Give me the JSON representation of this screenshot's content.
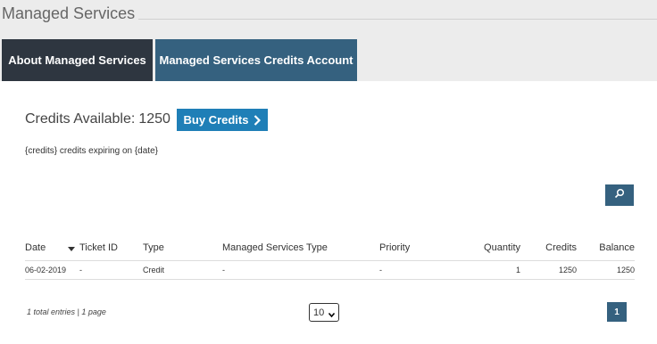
{
  "page": {
    "title": "Managed Services"
  },
  "tabs": [
    {
      "label": "About Managed Services"
    },
    {
      "label": "Managed Services Credits Account"
    }
  ],
  "credits": {
    "label": "Credits Available:",
    "value": "1250",
    "buy_label": "Buy Credits",
    "expiring_text": "{credits} credits expiring on {date}"
  },
  "table": {
    "headers": {
      "date": "Date",
      "ticket_id": "Ticket ID",
      "type": "Type",
      "managed_services_type": "Managed Services Type",
      "priority": "Priority",
      "quantity": "Quantity",
      "credits": "Credits",
      "balance": "Balance"
    },
    "rows": [
      {
        "date": "06-02-2019",
        "ticket_id": "-",
        "type": "Credit",
        "managed_services_type": "-",
        "priority": "-",
        "quantity": "1",
        "credits": "1250",
        "balance": "1250"
      }
    ]
  },
  "pagination": {
    "summary": "1 total entries | 1 page",
    "page_size": "10",
    "current_page": "1"
  },
  "icons": {
    "search": "search-icon",
    "buy_chevron": "chevron-right-icon",
    "sort": "sort-desc-icon"
  },
  "colors": {
    "tab_dark": "#2e3640",
    "tab_active": "#35617f",
    "buy_button": "#1f7fb7"
  }
}
